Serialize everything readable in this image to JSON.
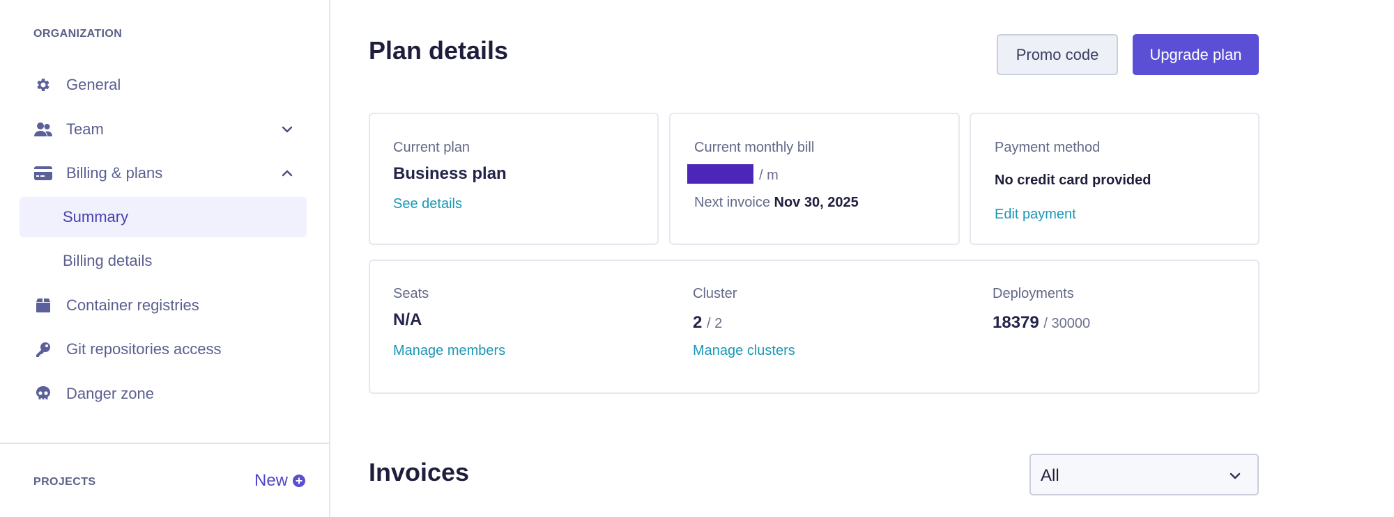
{
  "sidebar": {
    "organization_label": "ORGANIZATION",
    "items": [
      {
        "label": "General",
        "icon": "gear-icon"
      },
      {
        "label": "Team",
        "icon": "users-icon",
        "expandable": true,
        "expanded": false
      },
      {
        "label": "Billing & plans",
        "icon": "credit-card-icon",
        "expandable": true,
        "expanded": true
      },
      {
        "label": "Summary",
        "sub": true,
        "active": true
      },
      {
        "label": "Billing details",
        "sub": true
      },
      {
        "label": "Container registries",
        "icon": "box-icon"
      },
      {
        "label": "Git repositories access",
        "icon": "key-icon"
      },
      {
        "label": "Danger zone",
        "icon": "skull-icon"
      }
    ],
    "projects_label": "PROJECTS",
    "new_label": "New"
  },
  "header": {
    "title": "Plan details",
    "promo_label": "Promo code",
    "upgrade_label": "Upgrade plan"
  },
  "cards": {
    "plan": {
      "label": "Current plan",
      "value": "Business plan",
      "link": "See details"
    },
    "bill": {
      "label": "Current monthly bill",
      "amount": "[redacted]",
      "per": "/ m",
      "next_label": "Next invoice",
      "next_date": "Nov 30, 2025"
    },
    "payment": {
      "label": "Payment method",
      "value": "No credit card provided",
      "link": "Edit payment"
    }
  },
  "usage": {
    "seats": {
      "label": "Seats",
      "value": "N/A",
      "link": "Manage members"
    },
    "cluster": {
      "label": "Cluster",
      "used": "2",
      "limit": "/ 2",
      "link": "Manage clusters"
    },
    "deployments": {
      "label": "Deployments",
      "used": "18379",
      "limit": "/ 30000"
    }
  },
  "invoices": {
    "title": "Invoices",
    "filter_value": "All"
  },
  "colors": {
    "accent": "#5b4fd5",
    "link": "#1a97b5",
    "sidebar_text": "#5b5f8f",
    "active_bg": "#f0f1fc"
  }
}
